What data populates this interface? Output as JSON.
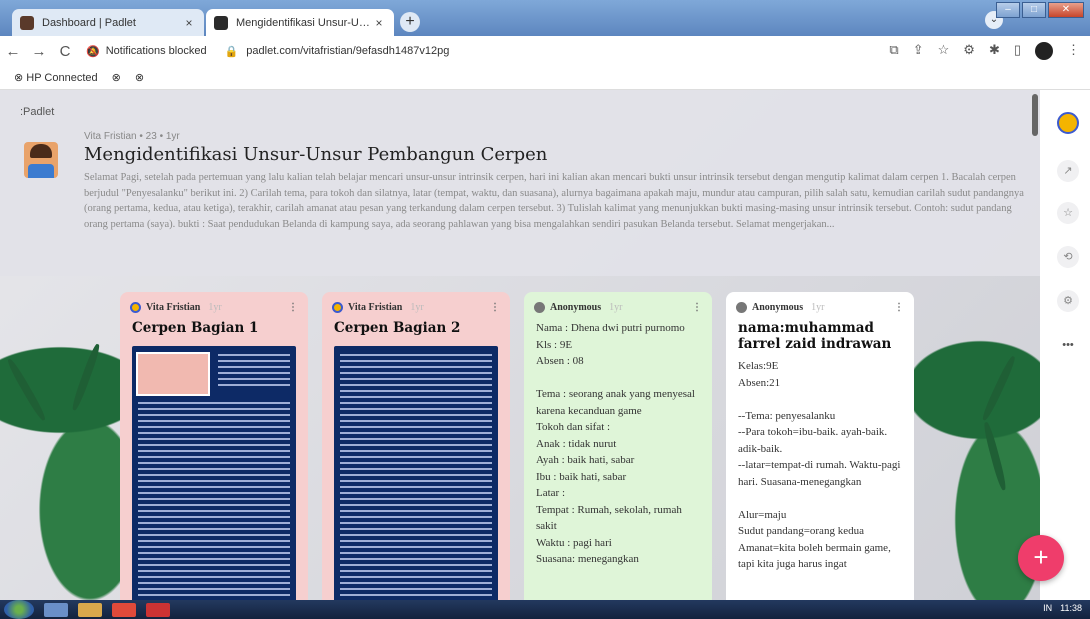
{
  "browser": {
    "tabs": [
      {
        "title": "Dashboard | Padlet",
        "close": "×",
        "active": false
      },
      {
        "title": "Mengidentifikasi Unsur-Unsur Pe",
        "close": "×",
        "active": true
      }
    ],
    "new_tab": "+",
    "notifications": "Notifications blocked",
    "url": "padlet.com/vitafristian/9efasdh1487v12pg",
    "bookmarks": [
      "HP Connected"
    ]
  },
  "padlet": {
    "brand": ":Padlet",
    "author": "Vita Fristian • 23 • 1yr",
    "title": "Mengidentifikasi Unsur-Unsur Pembangun Cerpen",
    "description": "Selamat Pagi, setelah pada pertemuan yang lalu kalian telah belajar mencari unsur-unsur intrinsik cerpen, hari ini kalian akan mencari bukti unsur intrinsik tersebut dengan mengutip kalimat dalam cerpen 1. Bacalah cerpen berjudul \"Penyesalanku\" berikut ini. 2) Carilah tema, para tokoh dan silatnya, latar (tempat, waktu, dan suasana), alurnya bagaimana apakah maju, mundur atau campuran, pilih salah satu, kemudian carilah sudut pandangnya (orang pertama, kedua, atau ketiga), terakhir, carilah amanat atau pesan yang terkandung dalam cerpen tersebut. 3) Tulislah kalimat yang menunjukkan bukti masing-masing unsur intrinsik tersebut. Contoh: sudut pandang orang pertama (saya). bukti : Saat pendudukan Belanda di kampung saya, ada seorang pahlawan yang bisa mengalahkan sendiri pasukan Belanda tersebut. Selamat mengerjakan..."
  },
  "cards": [
    {
      "author": "Vita Fristian",
      "ago": "1yr",
      "title": "Cerpen Bagian 1",
      "body": "",
      "color": "#f6cfcf"
    },
    {
      "author": "Vita Fristian",
      "ago": "1yr",
      "title": "Cerpen Bagian 2",
      "body": "",
      "color": "#f6cfcf"
    },
    {
      "author": "Anonymous",
      "ago": "1yr",
      "title": "",
      "body": "Nama : Dhena dwi putri purnomo\nKls : 9E\nAbsen : 08\n\nTema : seorang anak yang menyesal karena kecanduan game\nTokoh dan sifat :\nAnak : tidak nurut\nAyah : baik hati, sabar\nIbu : baik hati, sabar\nLatar :\nTempat : Rumah, sekolah, rumah sakit\nWaktu : pagi hari\nSuasana: menegangkan",
      "color": "#dff5d8"
    },
    {
      "author": "Anonymous",
      "ago": "1yr",
      "title": "nama:muhammad farrel zaid indrawan",
      "body": "Kelas:9E\nAbsen:21\n\n--Tema: penyesalanku\n--Para tokoh=ibu-baik. ayah-baik. adik-baik.\n--latar=tempat-di rumah. Waktu-pagi hari. Suasana-menegangkan\n\nAlur=maju\nSudut pandang=orang kedua\nAmanat=kita boleh bermain game, tapi kita juga harus ingat",
      "color": "#ffffff"
    }
  ],
  "more_glyph": "⋮",
  "fab": "+",
  "taskbar": {
    "lang": "IN",
    "time": "11:38"
  }
}
